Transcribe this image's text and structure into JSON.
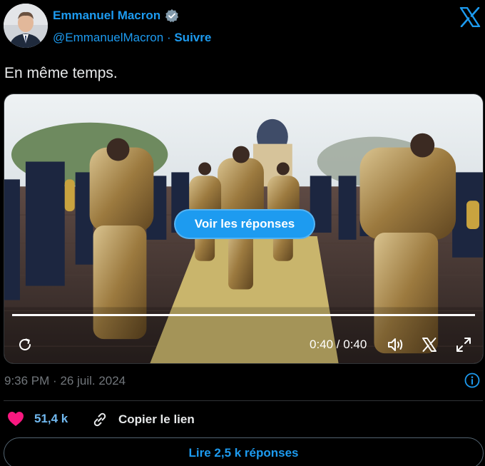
{
  "author": {
    "name": "Emmanuel Macron",
    "handle": "@EmmanuelMacron",
    "separator": "·",
    "follow_label": "Suivre"
  },
  "tweet": {
    "text": "En même temps."
  },
  "video": {
    "reply_overlay_label": "Voir les réponses",
    "time_display": "0:40 / 0:40",
    "progress_fraction": 1.0
  },
  "meta": {
    "time": "9:36 PM",
    "separator": "·",
    "date": "26 juil. 2024"
  },
  "actions": {
    "like_count": "51,4 k",
    "copy_link_label": "Copier le lien",
    "read_replies_label": "Lire 2,5 k réponses"
  },
  "colors": {
    "accent": "#1d9bf0",
    "like": "#f91880",
    "background": "#000000",
    "muted": "#71767b"
  }
}
